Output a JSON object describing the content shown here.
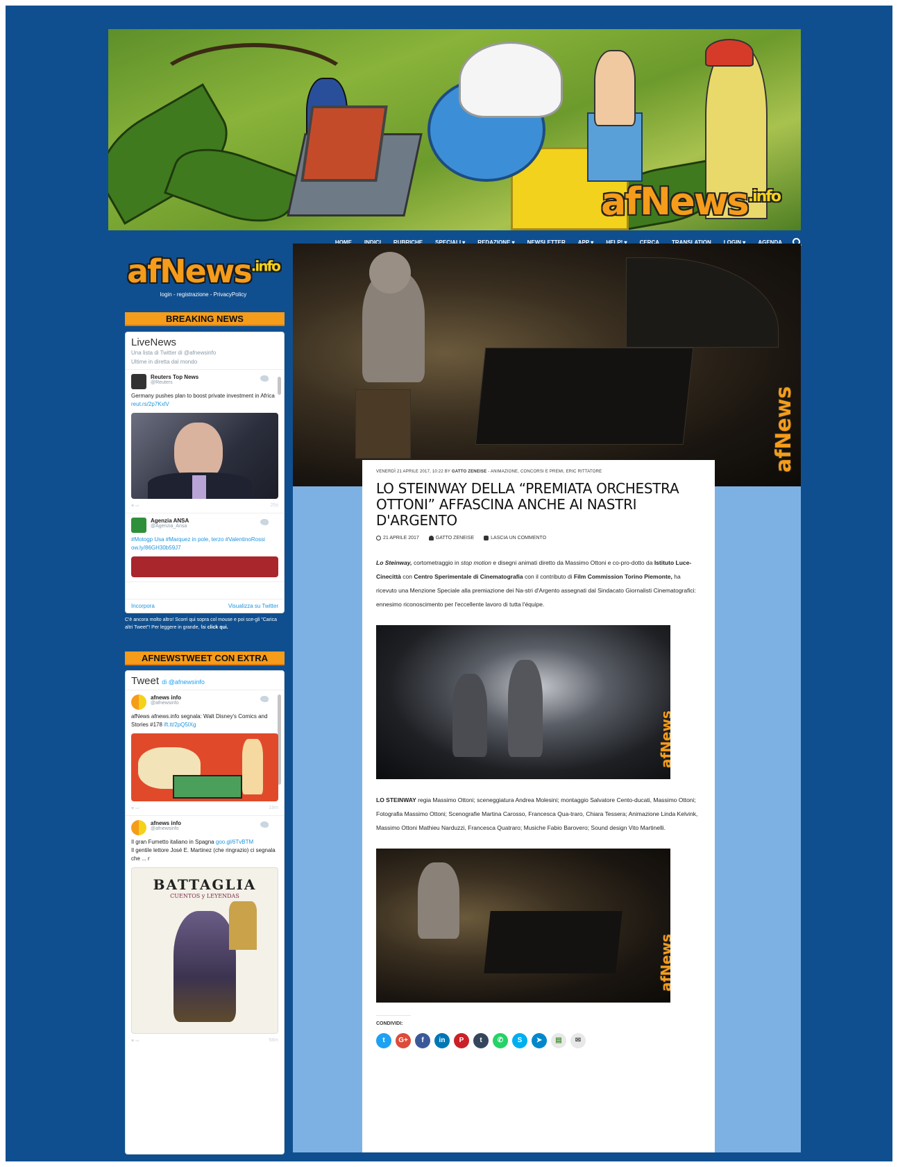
{
  "header": {
    "logo_main": "afNews",
    "logo_sup": ".info"
  },
  "nav": {
    "items": [
      "HOME",
      "INDICI",
      "RUBRICHE",
      "SPECIALI ▾",
      "REDAZIONE ▾",
      "NEWSLETTER",
      "APP ▾",
      "HELP! ▾",
      "CERCA",
      "TRANSLATION",
      "LOGIN ▾",
      "AGENDA"
    ]
  },
  "sidebar": {
    "logo_main": "afNews",
    "logo_sup": ".info",
    "logo_links": "login - registrazione - PrivacyPolicy",
    "breaking": {
      "title": "BREAKING NEWS",
      "widget_title": "LiveNews",
      "sub1": "Una lista di Twitter di @afnewsinfo",
      "sub2": "Ultime in diretta dal mondo",
      "tweets": [
        {
          "name": "Reuters Top News",
          "handle": "@Reuters",
          "text": "Germany pushes plan to boost private investment in Africa",
          "link": "reut.rs/2p7KxlV",
          "time": "25s"
        },
        {
          "name": "Agenzia ANSA",
          "handle": "@Agenzia_Ansa",
          "text": "#Motogp Usa #Marquez in pole, terzo #ValentinoRossi",
          "link": "ow.ly/86GH30b59J7"
        }
      ],
      "foot_left": "Incorpora",
      "foot_right": "Visualizza su Twitter",
      "note_pre": "C'è ancora molto altro! Scorri qui sopra col mouse e poi sce-gli \"Carica altri Tweet\"! Per leggere in grande, fai",
      "note_link": "click qui."
    },
    "extra": {
      "title": "AFNEWSTWEET CON EXTRA",
      "widget_title": "Tweet",
      "widget_by": "di @afnewsinfo",
      "tweets": [
        {
          "name": "afnews info",
          "handle": "@afnewsinfo",
          "text": "afNews afnews.info segnala: Walt Disney's Comics and Stories #178",
          "link": "ift.tt/2pQ5lXg",
          "time": "18m"
        },
        {
          "name": "afnews info",
          "handle": "@afnewsinfo",
          "text": "Il gran Fumetto italiano in Spagna",
          "link": "goo.gl/6TvBTM",
          "text2": "Il gentile lettore José E. Martinez (che ringrazio) ci segnala che ... r",
          "book_title": "BATTAGLIA",
          "book_sub": "CUENTOS y LEYENDAS",
          "time": "58m"
        }
      ]
    }
  },
  "article": {
    "meta_date": "VENERDÌ 21 APRILE 2017, 10:22 BY",
    "meta_author": "GATTO ZENEISE",
    "meta_cats": "- ANIMAZIONE, CONCORSI E PREMI, ERIC RITTATORE",
    "title": "LO STEINWAY DELLA “PREMIATA ORCHESTRA OTTONI” AFFASCINA ANCHE AI NASTRI D'ARGENTO",
    "date": "21 APRILE 2017",
    "author": "GATTO ZENEISE",
    "comment": "LASCIA UN COMMENTO",
    "body": {
      "p1_title": "Lo Steinway,",
      "p1_a": " cortometraggio in ",
      "p1_italic": "stop motion",
      "p1_b": " e disegni animati diretto da Massimo Ottoni e co-pro-dotto da ",
      "p1_org1": "Istituto Luce-Cinecittà",
      "p1_c": " con ",
      "p1_org2": "Centro Sperimentale di Cinematografia",
      "p1_d": " con il contributo di ",
      "p1_org3": "Film Commission Torino Piemonte,",
      "p1_e": " ha ricevuto una Menzione Speciale alla premiazione dei Na-stri d'Argento assegnati dal Sindacato Giornalisti Cinematografici: ennesimo riconoscimento per l'eccellente lavoro di tutta l'équipe."
    },
    "credits_title": "LO STEINWAY",
    "credits_text": " regia Massimo Ottoni; sceneggiatura Andrea Molesini; montaggio Salvatore Cento-ducati, Massimo Ottoni; Fotografia Massimo Ottoni; Scenografie Martina Carosso, Francesca Qua-traro, Chiara Tessera; Animazione Linda Kelvink, Massimo Ottoni Mathieu Narduzzi, Francesca Quatraro; Musiche Fabio Barovero; Sound design Vito Martinelli.",
    "share_label": "CONDIVIDI:",
    "share_buttons": [
      {
        "glyph": "t",
        "color": "#1da1f2"
      },
      {
        "glyph": "G+",
        "color": "#dd4b39"
      },
      {
        "glyph": "f",
        "color": "#3b5998"
      },
      {
        "glyph": "in",
        "color": "#0077b5"
      },
      {
        "glyph": "P",
        "color": "#cb2027"
      },
      {
        "glyph": "t",
        "color": "#35465c"
      },
      {
        "glyph": "✆",
        "color": "#25d366"
      },
      {
        "glyph": "S",
        "color": "#00aff0"
      },
      {
        "glyph": "➤",
        "color": "#0088cc"
      },
      {
        "glyph": "▤",
        "color": "#e8e8e8"
      },
      {
        "glyph": "✉",
        "color": "#e8e8e8"
      }
    ],
    "watermark": "afNews"
  }
}
